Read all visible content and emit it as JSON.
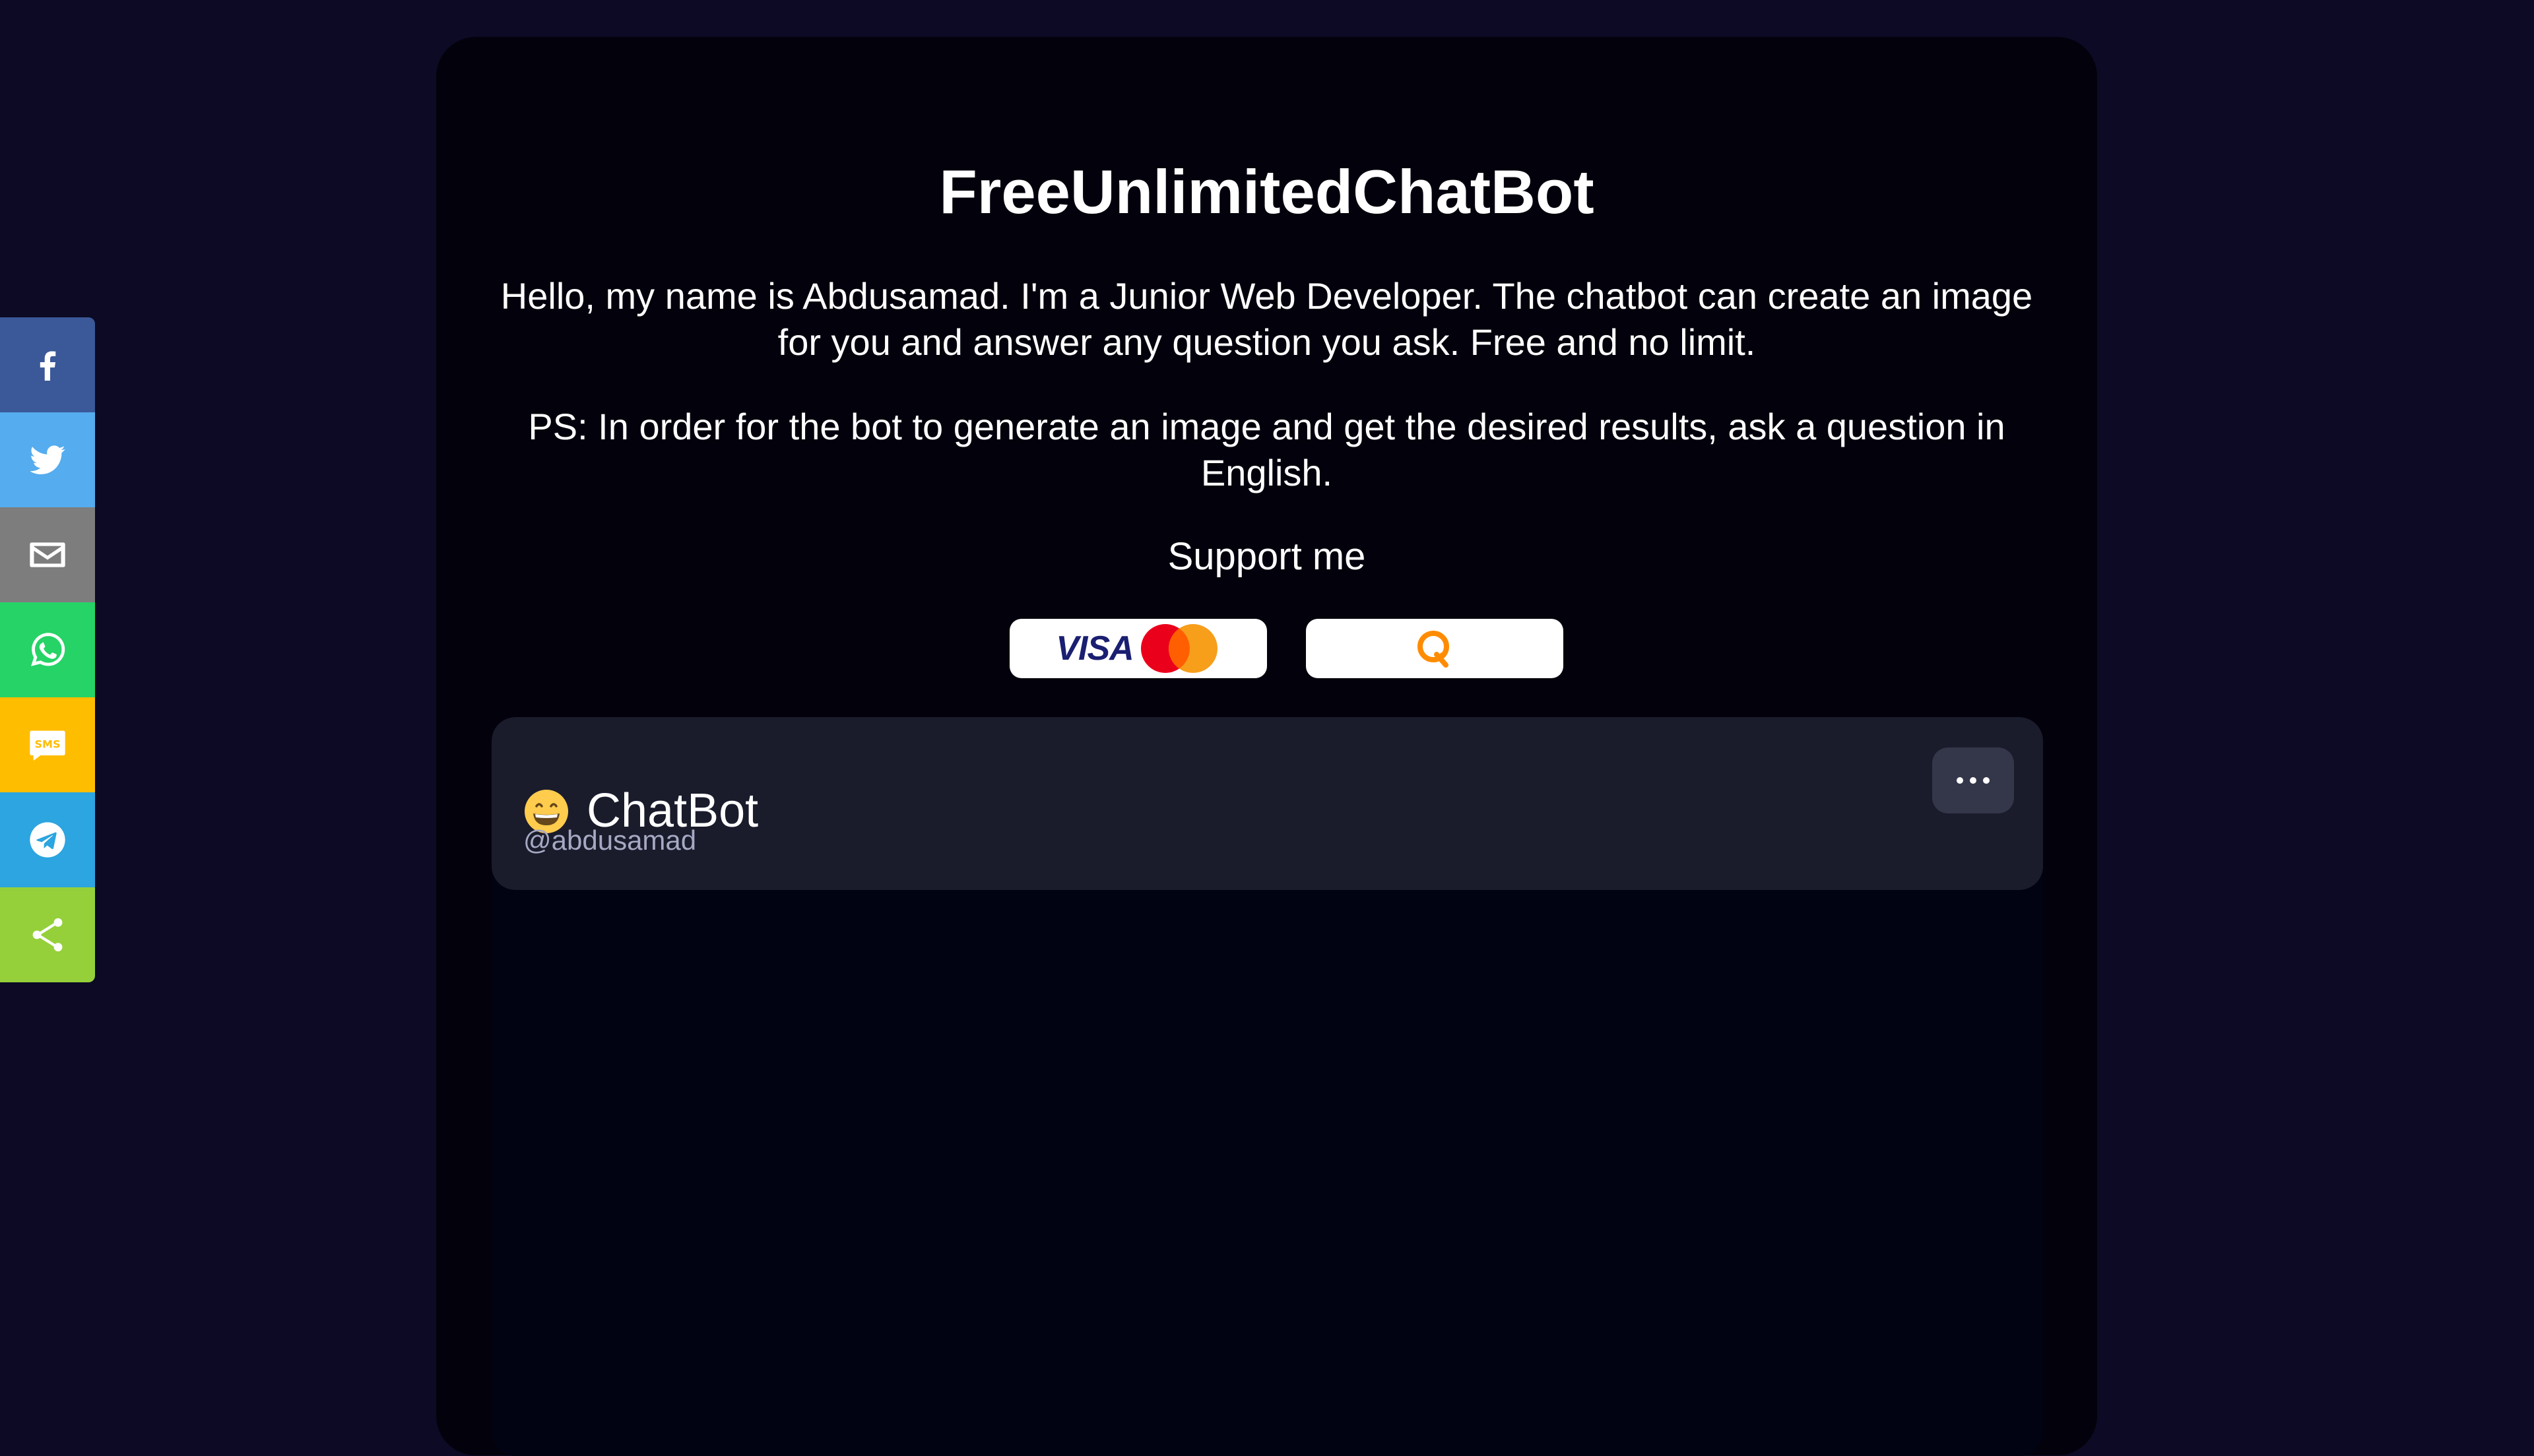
{
  "share": {
    "items": [
      {
        "name": "facebook",
        "icon": "facebook-icon",
        "color": "#3b5998"
      },
      {
        "name": "twitter",
        "icon": "twitter-icon",
        "color": "#55acee"
      },
      {
        "name": "email",
        "icon": "mail-icon",
        "color": "#7d7d7d"
      },
      {
        "name": "whatsapp",
        "icon": "whatsapp-icon",
        "color": "#25d366"
      },
      {
        "name": "sms",
        "icon": "sms-icon",
        "color": "#ffbd00"
      },
      {
        "name": "telegram",
        "icon": "telegram-icon",
        "color": "#2ca5e0"
      },
      {
        "name": "share",
        "icon": "share-icon",
        "color": "#95d03a"
      }
    ]
  },
  "header": {
    "title": "FreeUnlimitedChatBot",
    "intro": "Hello, my name is Abdusamad. I'm a Junior Web Developer. The chatbot can create an image for you and answer any question you ask. Free and no limit.",
    "ps": "PS: In order for the bot to generate an image and get the desired results, ask a question in English."
  },
  "support": {
    "title": "Support me",
    "visa_label": "VISA",
    "buttons": [
      {
        "name": "visa-mastercard",
        "icon": "visa-mastercard-logo"
      },
      {
        "name": "qiwi",
        "icon": "qiwi-logo"
      }
    ]
  },
  "chat": {
    "bot_emoji": "grinning-face-icon",
    "bot_name": "ChatBot",
    "bot_handle": "@abdusamad",
    "menu_icon": "more-horizontal-icon"
  },
  "colors": {
    "page_background": "#0c0a24",
    "card_background": "#03020c",
    "chat_header": "#1a1c2c",
    "menu_button": "#34374a"
  }
}
